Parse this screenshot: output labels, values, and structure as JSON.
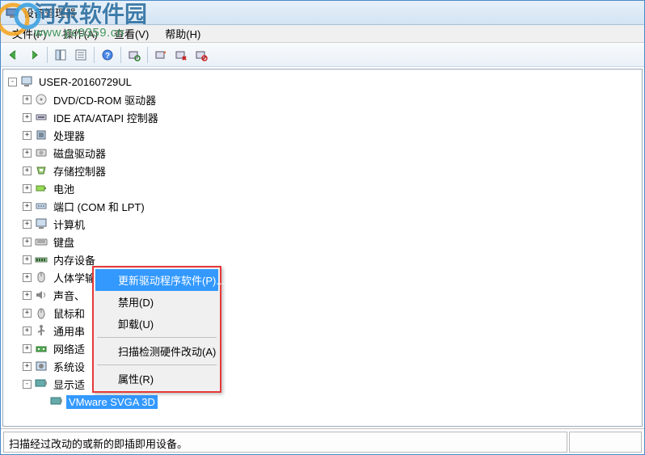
{
  "title": "设备管理器",
  "menu": {
    "file": "文件(F)",
    "action": "操作(A)",
    "view": "查看(V)",
    "help": "帮助(H)"
  },
  "root": "USER-20160729UL",
  "nodes": [
    {
      "label": "DVD/CD-ROM 驱动器",
      "icon": "disc"
    },
    {
      "label": "IDE ATA/ATAPI 控制器",
      "icon": "ide"
    },
    {
      "label": "处理器",
      "icon": "cpu"
    },
    {
      "label": "磁盘驱动器",
      "icon": "hdd"
    },
    {
      "label": "存储控制器",
      "icon": "storage"
    },
    {
      "label": "电池",
      "icon": "battery"
    },
    {
      "label": "端口 (COM 和 LPT)",
      "icon": "port"
    },
    {
      "label": "计算机",
      "icon": "computer"
    },
    {
      "label": "键盘",
      "icon": "keyboard"
    },
    {
      "label": "内存设备",
      "icon": "memory"
    },
    {
      "label": "人体学输入设备",
      "icon": "hid"
    },
    {
      "label": "声音、",
      "icon": "sound"
    },
    {
      "label": "鼠标和",
      "icon": "mouse"
    },
    {
      "label": "通用串",
      "icon": "usb"
    },
    {
      "label": "网络适",
      "icon": "network"
    },
    {
      "label": "系统设",
      "icon": "system"
    },
    {
      "label": "显示适",
      "icon": "display",
      "expanded": true
    }
  ],
  "selected_device": "VMware SVGA 3D",
  "context_menu": {
    "update": "更新驱动程序软件(P)...",
    "disable": "禁用(D)",
    "uninstall": "卸载(U)",
    "scan": "扫描检测硬件改动(A)",
    "properties": "属性(R)"
  },
  "status": "扫描经过改动的或新的即插即用设备。",
  "watermark": {
    "text": "河东软件园",
    "url": "www.pc0359.cn"
  }
}
